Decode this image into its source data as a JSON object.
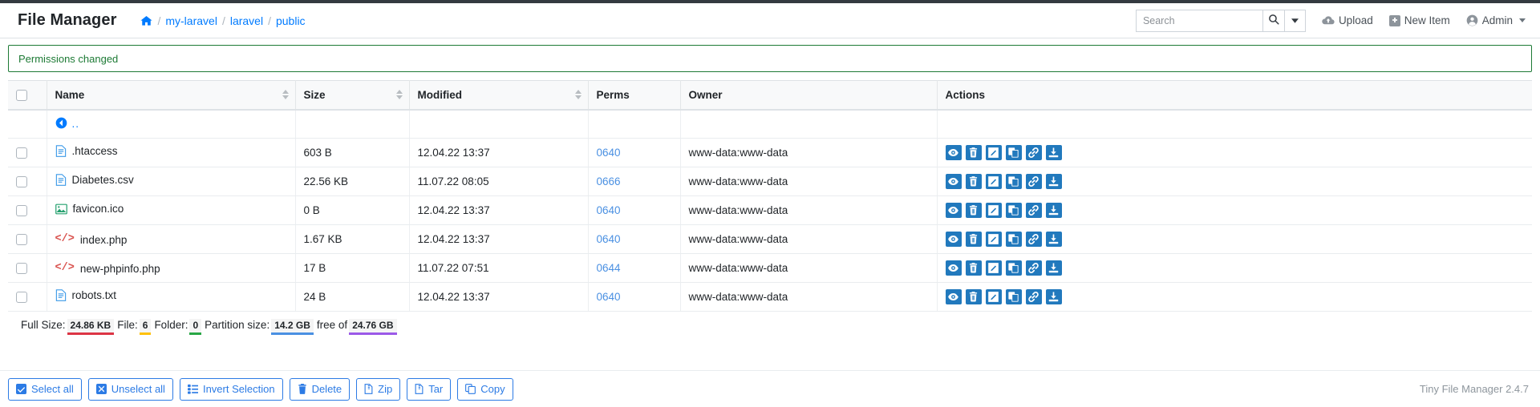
{
  "app": {
    "brand": "File Manager",
    "version_label": "Tiny File Manager 2.4.7"
  },
  "breadcrumb": {
    "home_icon": "home-icon",
    "items": [
      "my-laravel",
      "laravel",
      "public"
    ],
    "separator": "/"
  },
  "search": {
    "value": "",
    "placeholder": "Search",
    "search_icon": "search-icon",
    "caret_icon": "chevron-down-icon"
  },
  "nav_actions": {
    "upload": {
      "label": "Upload",
      "icon": "cloud-upload-icon"
    },
    "new_item": {
      "label": "New Item",
      "icon": "plus-square-icon"
    },
    "admin": {
      "label": "Admin",
      "icon": "user-circle-icon",
      "caret": "chevron-down-icon"
    }
  },
  "alert": {
    "message": "Permissions changed",
    "color": "#1d7a35"
  },
  "table": {
    "columns": {
      "name": "Name",
      "size": "Size",
      "modified": "Modified",
      "perms": "Perms",
      "owner": "Owner",
      "actions": "Actions"
    },
    "parent_row": {
      "label": "..",
      "icon": "arrow-circle-left-icon"
    },
    "action_icons": [
      "eye-icon",
      "trash-icon",
      "edit-icon",
      "copy-icon",
      "link-icon",
      "download-icon"
    ],
    "rows": [
      {
        "icon": "file-text-icon",
        "icon_color": "#3d9ae8",
        "name": ".htaccess",
        "size": "603 B",
        "modified": "12.04.22 13:37",
        "perms": "0640",
        "owner": "www-data:www-data"
      },
      {
        "icon": "file-text-icon",
        "icon_color": "#3d9ae8",
        "name": "Diabetes.csv",
        "size": "22.56 KB",
        "modified": "11.07.22 08:05",
        "perms": "0666",
        "owner": "www-data:www-data"
      },
      {
        "icon": "image-icon",
        "icon_color": "#23a06e",
        "name": "favicon.ico",
        "size": "0 B",
        "modified": "12.04.22 13:37",
        "perms": "0640",
        "owner": "www-data:www-data"
      },
      {
        "icon": "code-icon",
        "icon_color": "#d9534f",
        "name": "index.php",
        "size": "1.67 KB",
        "modified": "12.04.22 13:37",
        "perms": "0640",
        "owner": "www-data:www-data"
      },
      {
        "icon": "code-icon",
        "icon_color": "#d9534f",
        "name": "new-phpinfo.php",
        "size": "17 B",
        "modified": "11.07.22 07:51",
        "perms": "0644",
        "owner": "www-data:www-data"
      },
      {
        "icon": "file-text-icon",
        "icon_color": "#3d9ae8",
        "name": "robots.txt",
        "size": "24 B",
        "modified": "12.04.22 13:37",
        "perms": "0640",
        "owner": "www-data:www-data"
      }
    ]
  },
  "summary": {
    "full_size_label": "Full Size:",
    "full_size_value": "24.86 KB",
    "file_label": "File:",
    "file_value": "6",
    "folder_label": "Folder:",
    "folder_value": "0",
    "partition_label": "Partition size:",
    "partition_value": "14.2 GB",
    "free_of_label": "free of",
    "free_of_value": "24.76 GB"
  },
  "toolbar": {
    "select_all": {
      "label": "Select all",
      "icon": "checkbox-checked-icon"
    },
    "unselect_all": {
      "label": "Unselect all",
      "icon": "checkbox-x-icon"
    },
    "invert_selection": {
      "label": "Invert Selection",
      "icon": "list-icon"
    },
    "delete": {
      "label": "Delete",
      "icon": "trash-icon"
    },
    "zip": {
      "label": "Zip",
      "icon": "file-archive-icon"
    },
    "tar": {
      "label": "Tar",
      "icon": "file-archive-icon"
    },
    "copy": {
      "label": "Copy",
      "icon": "copy-icon"
    }
  },
  "colors": {
    "accent": "#007bff",
    "action_btn": "#2179bd",
    "toolbar_btn": "#2c7be5",
    "success": "#1d7a35"
  }
}
